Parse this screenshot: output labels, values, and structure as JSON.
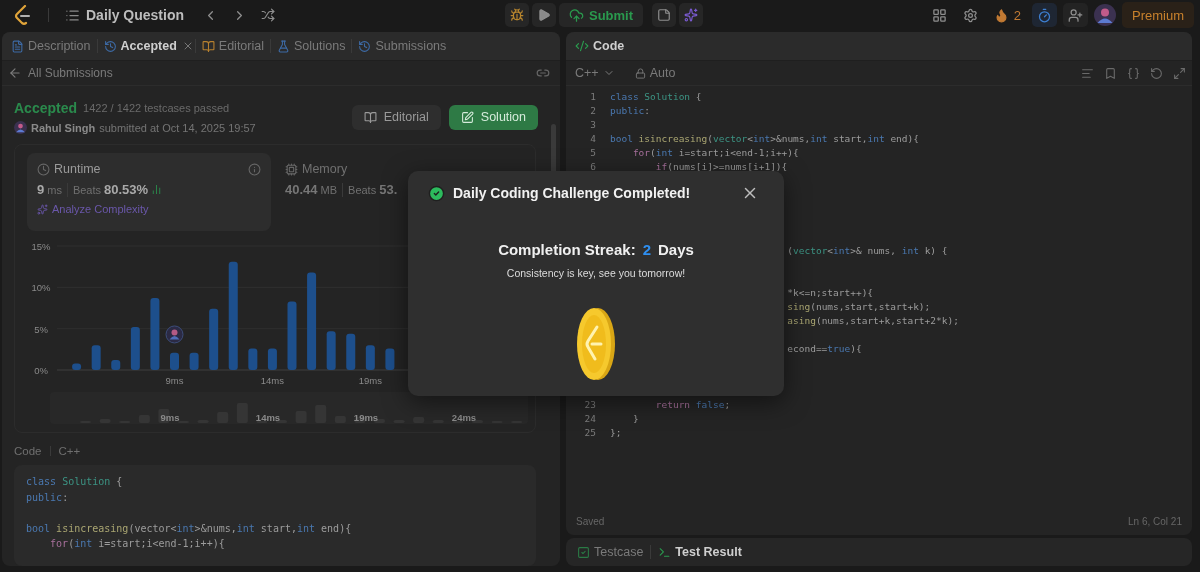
{
  "topbar": {
    "title": "Daily Question",
    "submit": "Submit",
    "streak": "2",
    "premium": "Premium"
  },
  "tabs": [
    {
      "label": "Description",
      "selected": false,
      "closable": false
    },
    {
      "label": "Accepted",
      "selected": true,
      "closable": true
    },
    {
      "label": "Editorial",
      "selected": false,
      "closable": false
    },
    {
      "label": "Solutions",
      "selected": false,
      "closable": false
    },
    {
      "label": "Submissions",
      "selected": false,
      "closable": false
    }
  ],
  "submission": {
    "back": "All Submissions",
    "status": "Accepted",
    "passed": "1422 / 1422 testcases passed",
    "user": "Rahul Singh",
    "submitted": "submitted at Oct 14, 2025 19:57",
    "buttons": [
      {
        "label": "Editorial",
        "kind": "secondary"
      },
      {
        "label": "Solution",
        "kind": "primary"
      }
    ]
  },
  "stats": [
    {
      "title": "Runtime",
      "value": "9",
      "unit": "ms",
      "beats_label": "Beats",
      "beats": "80.53%",
      "link": "Analyze Complexity",
      "selected": true
    },
    {
      "title": "Memory",
      "value": "40.44",
      "unit": "MB",
      "beats_label": "Beats",
      "beats": "53.",
      "selected": false
    }
  ],
  "chart_data": {
    "type": "bar",
    "x": [
      4,
      5,
      6,
      7,
      8,
      9,
      10,
      11,
      12,
      13,
      14,
      15,
      16,
      17,
      18,
      19,
      20
    ],
    "values": [
      0.8,
      3.0,
      1.2,
      5.2,
      8.7,
      2.1,
      2.1,
      7.4,
      13.1,
      2.6,
      2.6,
      8.3,
      11.8,
      4.7,
      4.4,
      3.0,
      2.6
    ],
    "xlim": [
      3,
      27
    ],
    "ylim": [
      0,
      15
    ],
    "xticks": [
      {
        "value": 9,
        "label": "9ms"
      },
      {
        "value": 14,
        "label": "14ms"
      },
      {
        "value": 19,
        "label": "19ms"
      }
    ],
    "yticks": [
      {
        "value": 0,
        "label": "0%"
      },
      {
        "value": 5,
        "label": "5%"
      },
      {
        "value": 10,
        "label": "10%"
      },
      {
        "value": 15,
        "label": "15%"
      }
    ]
  },
  "overview": {
    "labels": [
      "9ms",
      "14ms",
      "19ms",
      "24ms"
    ]
  },
  "code_view": {
    "label": "Code",
    "language": "C++",
    "lines": [
      {
        "kind": "code",
        "tokens": [
          {
            "kind": "keyword",
            "text": "class"
          },
          {
            "kind": "type",
            "text": " Solution"
          },
          {
            "kind": "plain",
            "text": " {"
          }
        ]
      },
      {
        "kind": "code",
        "tokens": [
          {
            "kind": "keyword",
            "text": "public"
          },
          {
            "kind": "plain",
            "text": ":"
          }
        ]
      },
      {
        "kind": "blank"
      },
      {
        "kind": "code",
        "tokens": [
          {
            "kind": "keyword",
            "text": "bool"
          },
          {
            "kind": "function",
            "text": " isincreasing"
          },
          {
            "kind": "plain",
            "text": "(vector<"
          },
          {
            "kind": "keyword",
            "text": "int"
          },
          {
            "kind": "plain",
            "text": ">&nums,"
          },
          {
            "kind": "keyword",
            "text": "int"
          },
          {
            "kind": "plain",
            "text": " start,"
          },
          {
            "kind": "keyword",
            "text": "int"
          },
          {
            "kind": "plain",
            "text": " end){"
          }
        ]
      },
      {
        "kind": "code",
        "tokens": [
          {
            "kind": "control",
            "text": "    for"
          },
          {
            "kind": "plain",
            "text": "("
          },
          {
            "kind": "keyword",
            "text": "int"
          },
          {
            "kind": "plain",
            "text": " i=start;i<end-1;i++){"
          }
        ]
      }
    ]
  },
  "editor": {
    "tab": "Code",
    "language": "C++",
    "mode": "Auto",
    "status": "Saved",
    "cursor": "Ln 6, Col 21",
    "lines": [
      {
        "kind": "full",
        "n": "1",
        "tokens": [
          {
            "kind": "keyword",
            "text": "class"
          },
          {
            "kind": "type",
            "text": " Solution"
          },
          {
            "kind": "plain",
            "text": " {"
          }
        ]
      },
      {
        "kind": "full",
        "n": "2",
        "tokens": [
          {
            "kind": "keyword",
            "text": "public"
          },
          {
            "kind": "plain",
            "text": ":"
          }
        ]
      },
      {
        "kind": "full",
        "n": "3"
      },
      {
        "kind": "full",
        "n": "4",
        "tokens": [
          {
            "kind": "keyword",
            "text": "bool"
          },
          {
            "kind": "function",
            "text": " isincreasing"
          },
          {
            "kind": "plain",
            "text": "("
          },
          {
            "kind": "type",
            "text": "vector"
          },
          {
            "kind": "plain",
            "text": "<"
          },
          {
            "kind": "keyword",
            "text": "int"
          },
          {
            "kind": "plain",
            "text": ">&nums,"
          },
          {
            "kind": "keyword",
            "text": "int"
          },
          {
            "kind": "plain",
            "text": " start,"
          },
          {
            "kind": "keyword",
            "text": "int"
          },
          {
            "kind": "plain",
            "text": " end){"
          }
        ]
      },
      {
        "kind": "full",
        "n": "5",
        "tokens": [
          {
            "kind": "control",
            "text": "    for"
          },
          {
            "kind": "plain",
            "text": "("
          },
          {
            "kind": "keyword",
            "text": "int"
          },
          {
            "kind": "plain",
            "text": " i=start;i<end-1;i++){"
          }
        ]
      },
      {
        "kind": "full",
        "n": "6",
        "tokens": [
          {
            "kind": "control",
            "text": "        if"
          },
          {
            "kind": "plain",
            "text": "(nums[i]>=nums[i+1]){"
          }
        ]
      },
      {
        "kind": "covered"
      },
      {
        "kind": "covered"
      },
      {
        "kind": "covered"
      },
      {
        "kind": "covered"
      },
      {
        "kind": "covered"
      },
      {
        "kind": "partial",
        "tokens": [
          {
            "kind": "plain",
            "text": "("
          },
          {
            "kind": "type",
            "text": "vector"
          },
          {
            "kind": "plain",
            "text": "<"
          },
          {
            "kind": "keyword",
            "text": "int"
          },
          {
            "kind": "plain",
            "text": ">& nums, "
          },
          {
            "kind": "keyword",
            "text": "int"
          },
          {
            "kind": "plain",
            "text": " k) {"
          }
        ]
      },
      {
        "kind": "covered"
      },
      {
        "kind": "covered"
      },
      {
        "kind": "partial",
        "tokens": [
          {
            "kind": "plain",
            "text": "*k<=n;start++){"
          }
        ]
      },
      {
        "kind": "partial",
        "tokens": [
          {
            "kind": "function",
            "text": "sing"
          },
          {
            "kind": "plain",
            "text": "(nums,start,start+k);"
          }
        ]
      },
      {
        "kind": "partial",
        "tokens": [
          {
            "kind": "function",
            "text": "asing"
          },
          {
            "kind": "plain",
            "text": "(nums,start+k,start+2*k);"
          }
        ]
      },
      {
        "kind": "covered"
      },
      {
        "kind": "partial",
        "tokens": [
          {
            "kind": "plain",
            "text": "econd=="
          },
          {
            "kind": "keyword",
            "text": "true"
          },
          {
            "kind": "plain",
            "text": "){"
          }
        ]
      },
      {
        "kind": "covered"
      },
      {
        "kind": "covered"
      },
      {
        "kind": "covered"
      },
      {
        "kind": "full",
        "n": "23",
        "tokens": [
          {
            "kind": "control",
            "text": "        return"
          },
          {
            "kind": "keyword",
            "text": " false"
          },
          {
            "kind": "plain",
            "text": ";"
          }
        ]
      },
      {
        "kind": "full",
        "n": "24",
        "tokens": [
          {
            "kind": "plain",
            "text": "    }"
          }
        ]
      },
      {
        "kind": "full",
        "n": "25",
        "tokens": [
          {
            "kind": "plain",
            "text": "};"
          }
        ]
      }
    ]
  },
  "bottom_tabs": [
    {
      "label": "Testcase",
      "selected": false
    },
    {
      "label": "Test Result",
      "selected": true
    }
  ],
  "modal": {
    "title": "Daily Coding Challenge Completed!",
    "streak_label": "Completion Streak:",
    "streak_value": "2",
    "streak_unit": "Days",
    "message": "Consistency is key, see you tomorrow!"
  }
}
